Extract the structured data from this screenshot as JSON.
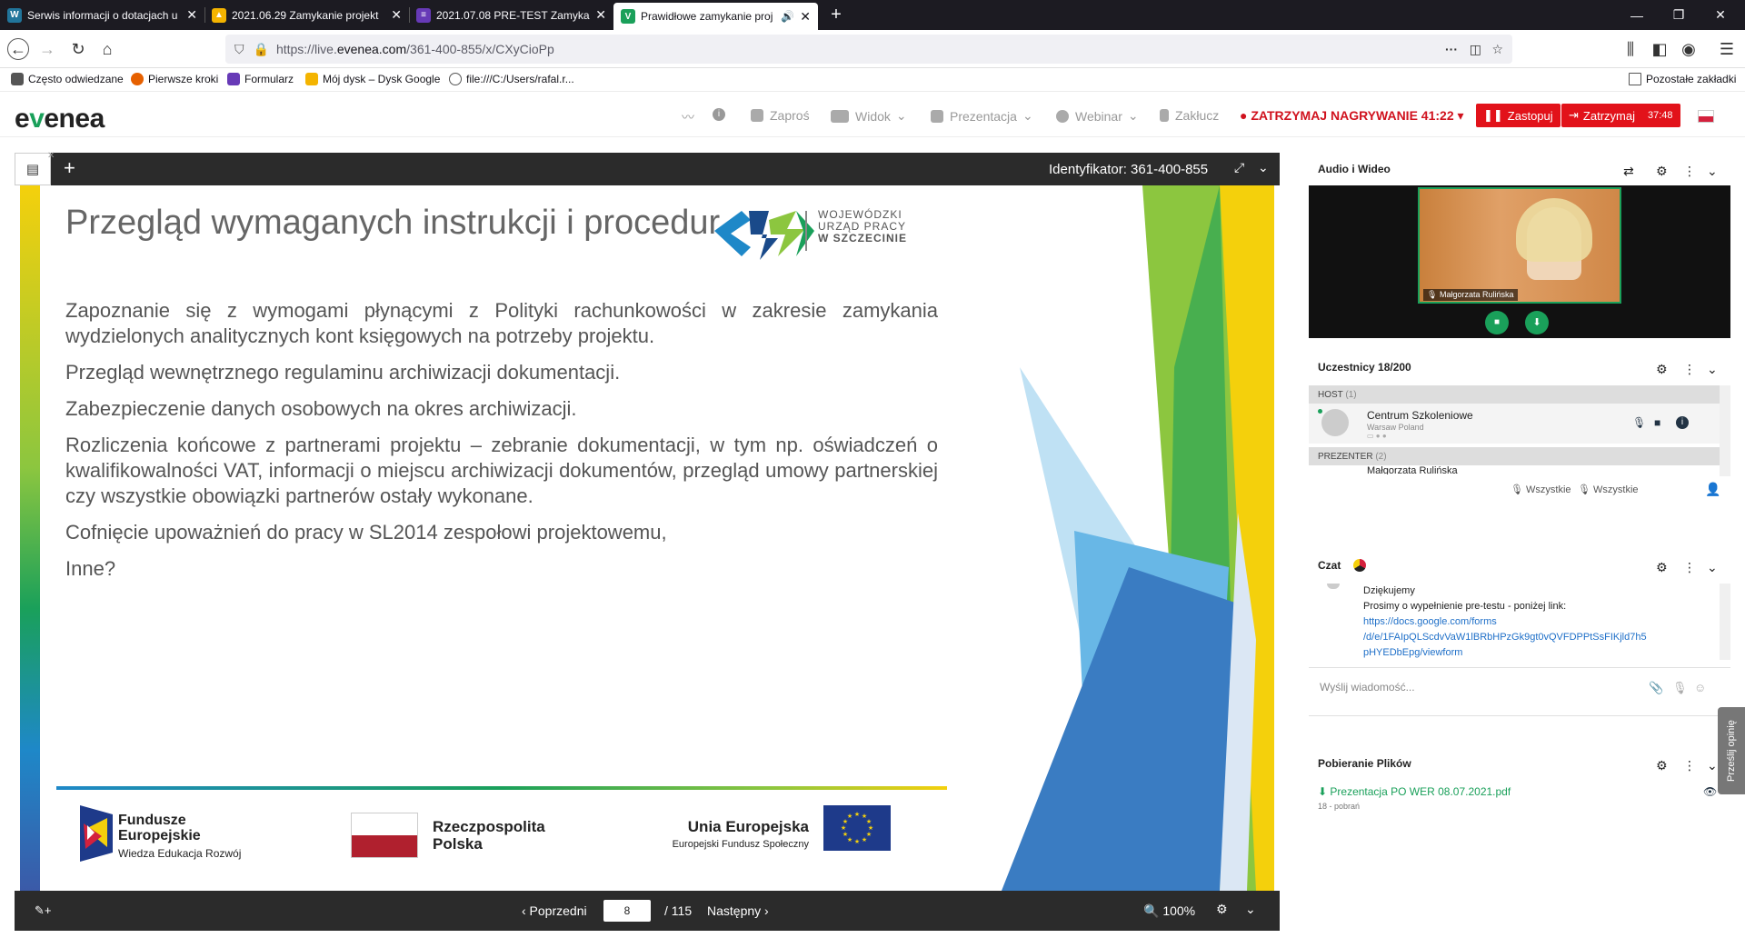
{
  "browser": {
    "tabs": [
      {
        "title": "Serwis informacji o dotacjach u",
        "favicon_color": "#21759b",
        "favicon": "W"
      },
      {
        "title": "2021.06.29 Zamykanie projekt",
        "favicon_color": "#f4b400",
        "favicon": "▲"
      },
      {
        "title": "2021.07.08 PRE-TEST Zamykani",
        "favicon_color": "#673ab7",
        "favicon": "≡"
      },
      {
        "title": "Prawidłowe zamykanie proj",
        "favicon_color": "#1aa05a",
        "favicon": "V",
        "active": true
      }
    ],
    "new_tab": "+",
    "url": "https://live.evenea.com/361-400-855/x/CXyCioPp",
    "url_host": "evenea.com",
    "url_prefix": "https://live.",
    "url_path": "/361-400-855/x/CXyCioPp",
    "url_menu": "···",
    "bookmarks": [
      {
        "label": "Często odwiedzane",
        "color": "#555"
      },
      {
        "label": "Pierwsze kroki",
        "color": "#e66000"
      },
      {
        "label": "Formularz",
        "color": "#673ab7"
      },
      {
        "label": "Mój dysk – Dysk Google",
        "color": "#f4b400"
      },
      {
        "label": "file:///C:/Users/rafal.r...",
        "color": "#888"
      }
    ],
    "other_bookmarks": "Pozostałe zakładki"
  },
  "app": {
    "logo_e": "e",
    "logo_v": "v",
    "logo_rest": "enea",
    "menu": {
      "invite": "Zaproś",
      "view": "Widok",
      "presentation": "Prezentacja",
      "webinar": "Webinar",
      "lock": "Zakłucz"
    },
    "record_stop": "ZATRZYMAJ NAGRYWANIE 41:22",
    "stop_btn": "Zastopuj",
    "pause_btn": "Zatrzymaj",
    "pause_timer": "37:48",
    "brand_color": "#1aa05a"
  },
  "presentation": {
    "identifier": "Identyfikator: 361-400-855",
    "add_label": "+",
    "slide": {
      "title": "Przegląd wymaganych instrukcji i procedur",
      "logo_lines": [
        "WOJEWÓDZKI",
        "URZĄD PRACY",
        "W SZCZECINIE"
      ],
      "paragraphs": [
        "Zapoznanie się z wymogami płynącymi z Polityki rachunkowości w zakresie zamykania wydzielonych analitycznych kont księgowych na potrzeby projektu.",
        "Przegląd wewnętrznego regulaminu archiwizacji dokumentacji.",
        "Zabezpieczenie danych osobowych na okres archiwizacji.",
        "Rozliczenia końcowe z partnerami projektu – zebranie dokumentacji, w tym np. oświadczeń o kwalifikowalności VAT, informacji o miejscu archiwizacji dokumentów, przegląd umowy partnerskiej czy wszystkie obowiązki partnerów ostały wykonane.",
        "Cofnięcie upoważnień do pracy w SL2014 zespołowi projektowemu,",
        "Inne?"
      ],
      "footer": {
        "fe_title1": "Fundusze",
        "fe_title2": "Europejskie",
        "fe_sub": "Wiedza Edukacja Rozwój",
        "rp1": "Rzeczpospolita",
        "rp2": "Polska",
        "ue_title": "Unia Europejska",
        "ue_sub": "Europejski Fundusz Społeczny"
      }
    },
    "footer": {
      "prev": "‹ Poprzedni",
      "page": "8",
      "total": "/ 115",
      "next": "Następny ›",
      "zoom": "100%"
    }
  },
  "panels": {
    "av": {
      "title": "Audio i Wideo",
      "speaker": "Małgorzata Rulińska"
    },
    "participants": {
      "title": "Uczestnicy 18/200",
      "host_header": "HOST",
      "host_count": "(1)",
      "host_name": "Centrum Szkoleniowe",
      "host_location": "Warsaw Poland",
      "presenter_header": "PREZENTER",
      "presenter_count": "(2)",
      "presenter_name": "Małgorzata Rulińska",
      "all_mic": "Wszystkie",
      "all_cam": "Wszystkie"
    },
    "chat": {
      "title": "Czat",
      "messages": [
        "Dziękujemy",
        "Prosimy o wypełnienie pre-testu - poniżej link:"
      ],
      "link_lines": [
        "https://docs.google.com/forms",
        "/d/e/1FAIpQLScdvVaW1lBRbHPzGk9gt0vQVFDPPtSsFIKjld7h5",
        "pHYEDbEpg/viewform"
      ],
      "input_placeholder": "Wyślij wiadomość..."
    },
    "files": {
      "title": "Pobieranie Plików",
      "file_name": "Prezentacja PO WER 08.07.2021.pdf",
      "file_meta": "18 - pobrań"
    },
    "feedback": "Prześlij opinię"
  }
}
